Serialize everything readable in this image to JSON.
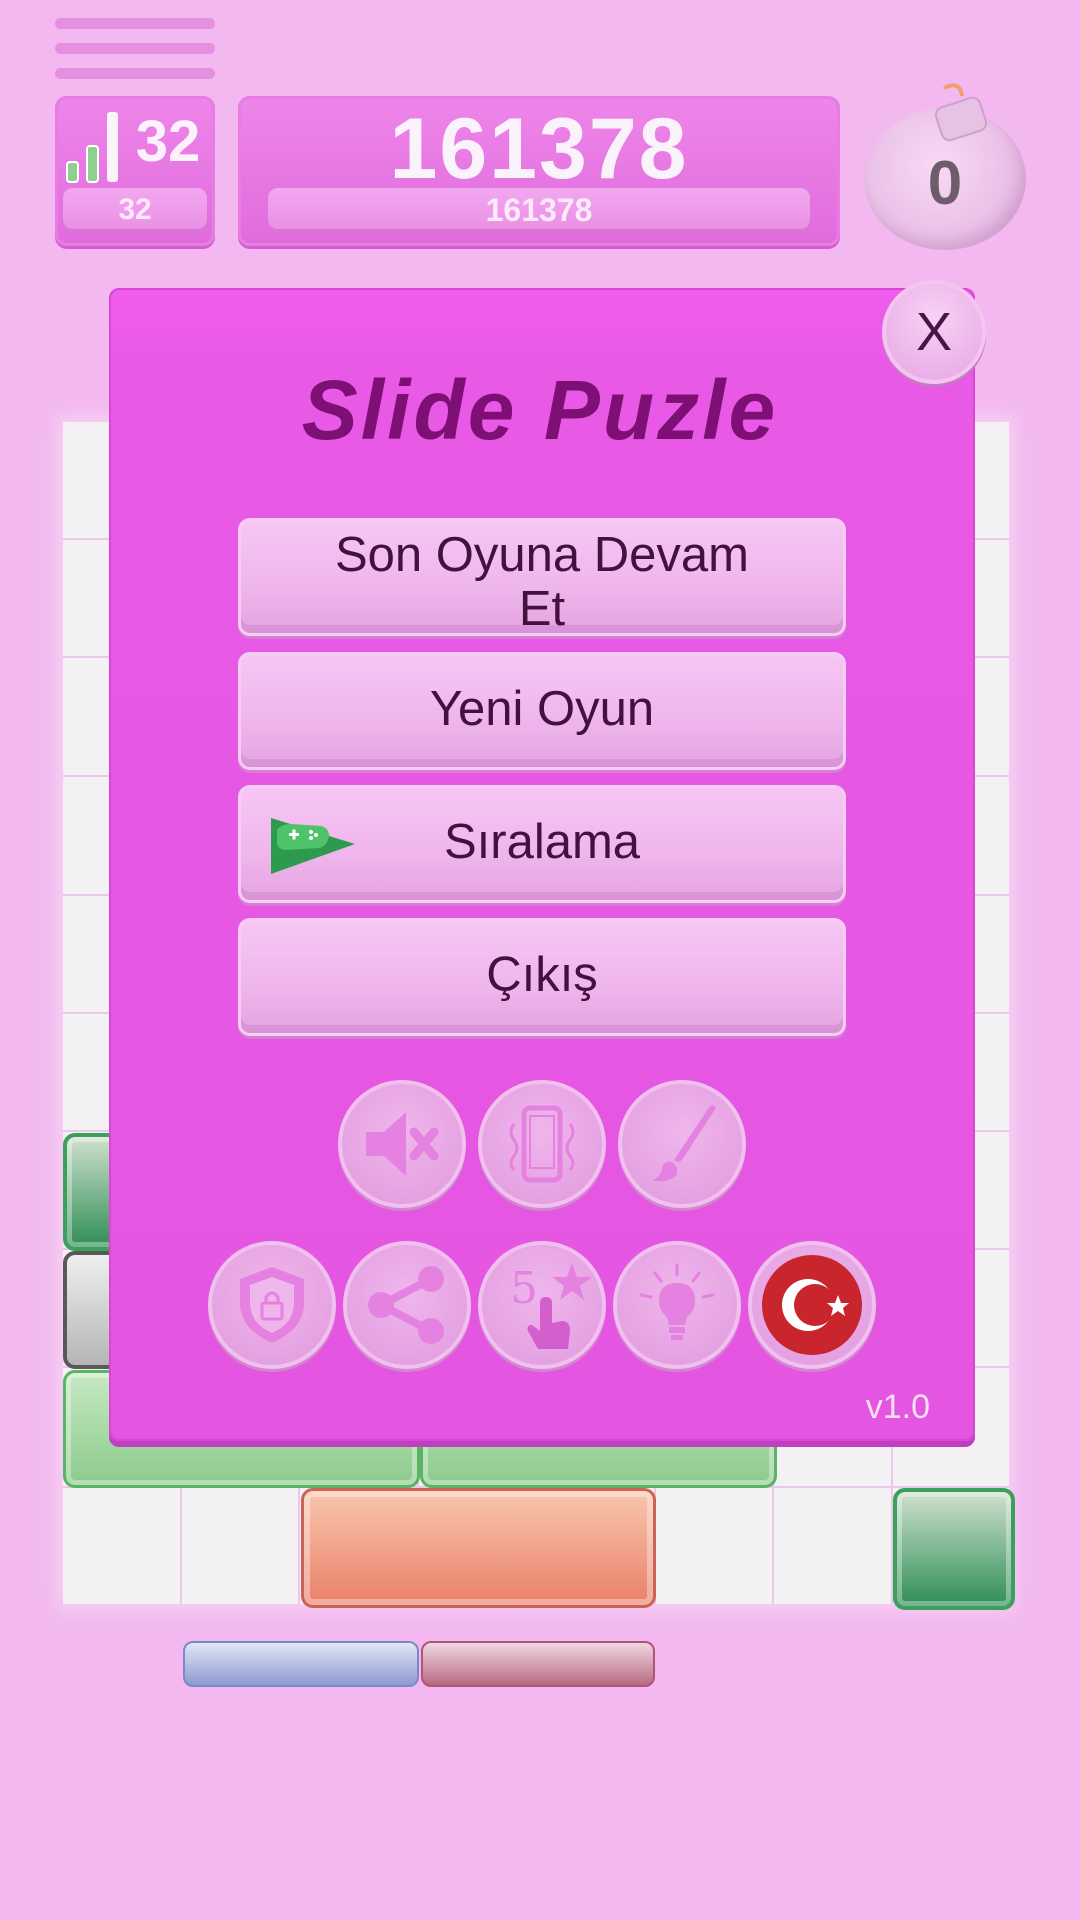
{
  "hud": {
    "level_value": "32",
    "level_sub": "32",
    "score_value": "161378",
    "score_sub": "161378",
    "bomb_count": "0"
  },
  "modal": {
    "title": "Slide Puzle",
    "close_label": "X",
    "buttons": {
      "continue_line1": "Son Oyuna Devam",
      "continue_line2": "Et",
      "new_game": "Yeni Oyun",
      "leaderboard": "Sıralama",
      "exit": "Çıkış"
    },
    "version": "v1.0"
  },
  "icons": {
    "row1": [
      "mute-icon",
      "vibrate-icon",
      "brush-icon"
    ],
    "row2": [
      "privacy-shield-icon",
      "share-icon",
      "rate-icon",
      "hint-icon",
      "turkey-flag-icon"
    ],
    "rate_number": "5"
  },
  "colors": {
    "background": "#f2b8ef",
    "modal": "#e455e1",
    "title": "#7e0f74",
    "button_text": "#43103f"
  }
}
